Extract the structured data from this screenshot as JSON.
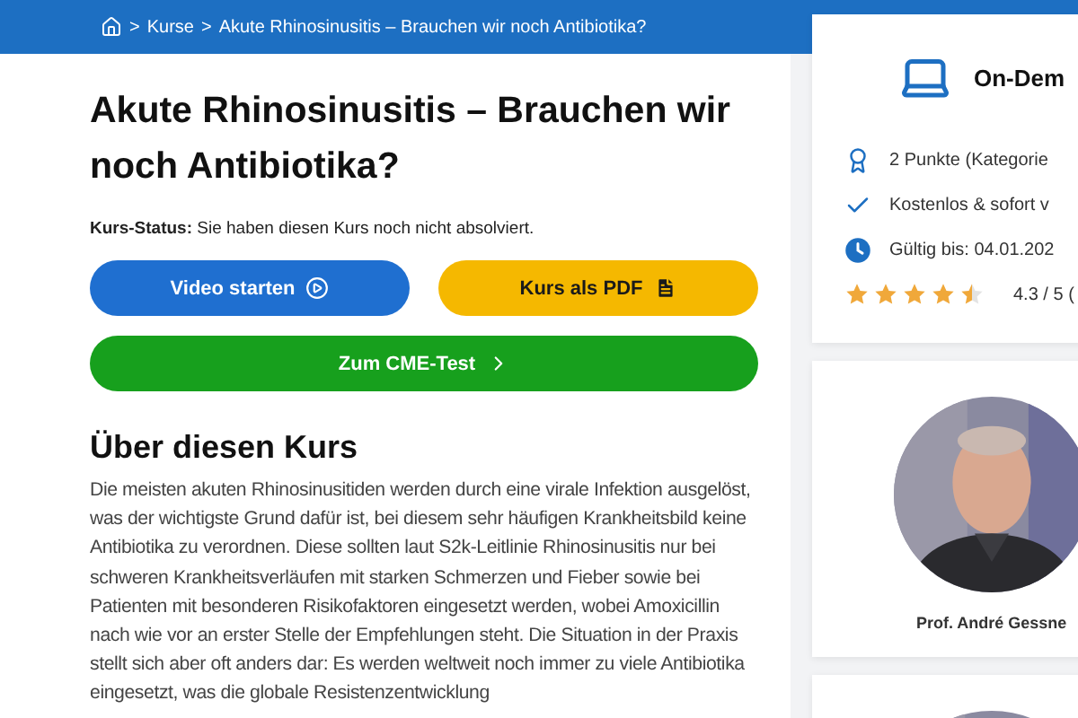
{
  "breadcrumb": [
    {
      "label": "Kurse"
    },
    {
      "label": "Akute Rhinosinusitis – Brauchen wir noch Antibiotika?"
    }
  ],
  "breadcrumb_separator": ">",
  "title": "Akute Rhinosinusitis – Brauchen wir noch Antibiotika?",
  "status": {
    "label": "Kurs-Status:",
    "text": "Sie haben diesen Kurs noch nicht absolviert."
  },
  "buttons": [
    {
      "label": "Video starten",
      "kind": "video"
    },
    {
      "label": "Kurs als PDF",
      "kind": "pdf"
    },
    {
      "label": "Zum CME-Test",
      "kind": "test"
    }
  ],
  "about": {
    "heading": "Über diesen Kurs",
    "text": "Die meisten akuten Rhinosinusitiden werden durch eine virale Infektion ausgelöst, was der wichtigste Grund dafür ist, bei diesem sehr häufigen Krankheitsbild keine Antibiotika zu verordnen. Diese sollten laut S2k-Leitlinie Rhinosinusitis nur bei schweren Krankheitsverläufen mit starken Schmerzen und Fieber sowie bei Patienten mit besonderen Risikofaktoren eingesetzt werden, wobei Amoxicillin nach wie vor an erster Stelle der Empfehlungen steht. Die Situation in der Praxis stellt sich aber oft anders dar: Es werden weltweit noch immer zu viele Antibiotika eingesetzt, was die globale Resistenzentwicklung"
  },
  "info_card": {
    "title": "On-Dem",
    "facts": [
      {
        "kind": "points",
        "text": "2 Punkte (Kategorie"
      },
      {
        "kind": "free",
        "text": "Kostenlos & sofort v"
      },
      {
        "kind": "valid",
        "text": "Gültig bis: 04.01.202"
      }
    ],
    "stars": 4.5,
    "rating": "4.3 / 5 ("
  },
  "speakers": [
    {
      "name": "Prof. André Gessne",
      "kind": "picture"
    },
    {
      "kind": "picture"
    }
  ]
}
